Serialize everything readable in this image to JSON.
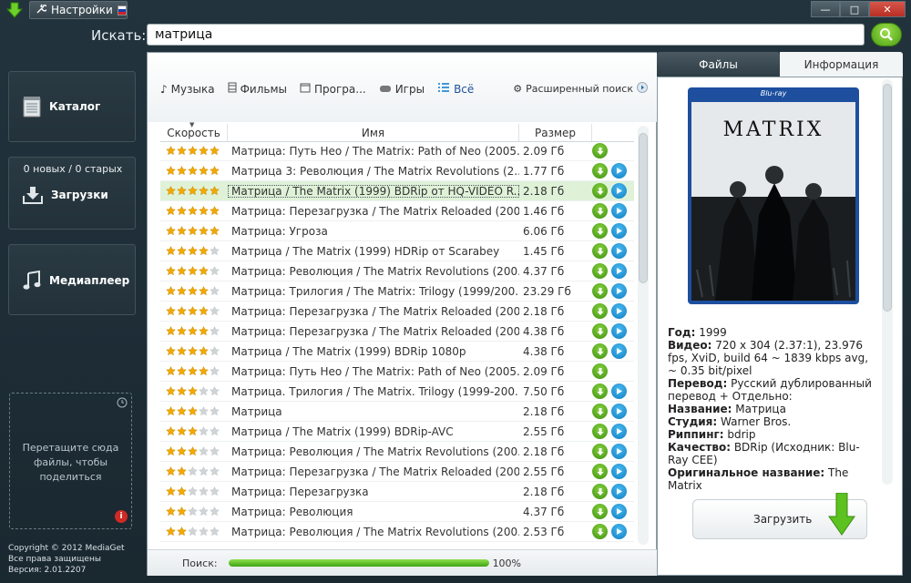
{
  "window": {
    "settings_label": "Настройки",
    "controls": {
      "minimize": "—",
      "maximize": "□",
      "close": "✕"
    }
  },
  "search": {
    "label": "Искать:",
    "value": "матрица"
  },
  "sidebar": {
    "catalog": "Каталог",
    "downloads_count": "0 новых / 0 старых",
    "downloads": "Загрузки",
    "player": "Медиаплеер",
    "drop_zone": "Перетащите сюда файлы, чтобы поделиться",
    "drop_badge": "i",
    "copyright": [
      "Copyright © 2012 MediaGet",
      "Все права защищены",
      "Версия: 2.01.2207"
    ]
  },
  "filters": {
    "music": "Музыка",
    "movies": "Фильмы",
    "programs": "Програ...",
    "games": "Игры",
    "all": "Всё",
    "advanced": "Расширенный поиск"
  },
  "table": {
    "headers": {
      "speed": "Скорость",
      "name": "Имя",
      "size": "Размер"
    },
    "rows": [
      {
        "stars": 5,
        "name": "Матрица: Путь Нео / The Matrix: Path of Neo (2005...",
        "size": "2.09 Гб",
        "play": false
      },
      {
        "stars": 5,
        "name": "Матрица 3: Революция / The Matrix Revolutions (2...",
        "size": "1.77 Гб",
        "play": true
      },
      {
        "stars": 5,
        "name": "Матрица / The Matrix (1999) BDRip от HQ-VIDEO  R...",
        "size": "2.18 Гб",
        "play": true,
        "selected": true
      },
      {
        "stars": 5,
        "name": "Матрица: Перезагрузка / The Matrix Reloaded (200...",
        "size": "1.46 Гб",
        "play": true
      },
      {
        "stars": 5,
        "name": "Матрица: Угроза",
        "size": "6.06 Гб",
        "play": true
      },
      {
        "stars": 4,
        "name": "Матрица / The Matrix (1999) HDRip от Scarabey",
        "size": "1.45 Гб",
        "play": true
      },
      {
        "stars": 4,
        "name": "Матрица: Революция / The Matrix Revolutions (200...",
        "size": "4.37 Гб",
        "play": true
      },
      {
        "stars": 4,
        "name": "Матрица: Трилогия / The Matrix: Trilogy (1999/200...",
        "size": "23.29 Гб",
        "play": true
      },
      {
        "stars": 4,
        "name": "Матрица: Перезагрузка / The Matrix Reloaded (200...",
        "size": "2.18 Гб",
        "play": true
      },
      {
        "stars": 4,
        "name": "Матрица: Перезагрузка / The Matrix Reloaded (200...",
        "size": "4.38 Гб",
        "play": true
      },
      {
        "stars": 4,
        "name": "Матрица / The Matrix (1999) BDRip 1080p",
        "size": "4.38 Гб",
        "play": true
      },
      {
        "stars": 4,
        "name": "Матрица: Путь Нео / The Matrix: Path of Neo (2005...",
        "size": "2.09 Гб",
        "play": false
      },
      {
        "stars": 3,
        "name": "Матрица. Трилогия / The Matrix. Trilogy (1999-200...",
        "size": "7.50 Гб",
        "play": true
      },
      {
        "stars": 3,
        "name": "Матрица",
        "size": "2.18 Гб",
        "play": true
      },
      {
        "stars": 3,
        "name": "Матрица / The Matrix (1999) BDRip-AVC",
        "size": "2.55 Гб",
        "play": true
      },
      {
        "stars": 3,
        "name": "Матрица: Революция / The Matrix Revolutions (200...",
        "size": "2.18 Гб",
        "play": true
      },
      {
        "stars": 2,
        "name": "Матрица: Перезагрузка / The Matrix Reloaded (200...",
        "size": "2.55 Гб",
        "play": true
      },
      {
        "stars": 2,
        "name": "Матрица: Перезагрузка",
        "size": "2.18 Гб",
        "play": true
      },
      {
        "stars": 2,
        "name": "Матрица: Революция",
        "size": "4.37 Гб",
        "play": true
      },
      {
        "stars": 2,
        "name": "Матрица: Революция / The Matrix Revolutions (200...",
        "size": "2.53 Гб",
        "play": true
      }
    ]
  },
  "status": {
    "label": "Поиск:",
    "progress": 100,
    "percent": "100%"
  },
  "tabs": {
    "files": "Файлы",
    "info": "Информация"
  },
  "cover": {
    "title": "MATRIX",
    "brand": "Blu-ray"
  },
  "info": [
    {
      "k": "Год:",
      "v": "1999"
    },
    {
      "k": "Видео:",
      "v": "720 x 304 (2.37:1), 23.976 fps, XviD, build 64 ~ 1839 kbps avg, ~ 0.35 bit/pixel"
    },
    {
      "k": "Перевод:",
      "v": "Русский дублированный перевод + Отдельно:"
    },
    {
      "k": "Название:",
      "v": "Матрица"
    },
    {
      "k": "Студия:",
      "v": "Warner Bros."
    },
    {
      "k": "Риппинг:",
      "v": "bdrip"
    },
    {
      "k": "Качество:",
      "v": "BDRip (Исходник: Blu-Ray CEE)"
    },
    {
      "k": "Оригинальное название:",
      "v": "The Matrix"
    }
  ],
  "download_button": "Загрузить",
  "colors": {
    "accent_green": "#4c9f14",
    "play_blue": "#117ec2",
    "star": "#f2a900",
    "selected_row": "#dff2d8"
  }
}
